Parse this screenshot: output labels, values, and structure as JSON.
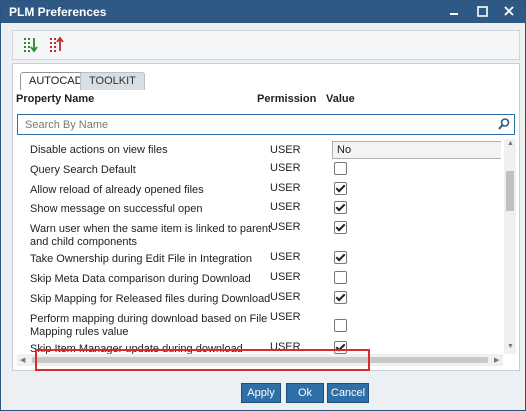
{
  "window": {
    "title": "PLM Preferences",
    "minimize_icon": "minimize-icon",
    "maximize_icon": "maximize-icon",
    "close_icon": "close-icon"
  },
  "toolbar": {
    "expand_icon": "expand-all-icon",
    "collapse_icon": "collapse-all-icon"
  },
  "tabs": [
    {
      "label": "AUTOCAD",
      "active": true
    },
    {
      "label": "TOOLKIT",
      "active": false
    }
  ],
  "headers": {
    "property": "Property Name",
    "permission": "Permission",
    "value": "Value"
  },
  "search": {
    "placeholder": "Search By Name",
    "value": ""
  },
  "rows": [
    {
      "name": "Disable actions on view files",
      "permission": "USER",
      "type": "dropdown",
      "value": "No"
    },
    {
      "name": "Query Search Default",
      "permission": "USER",
      "type": "checkbox",
      "checked": false
    },
    {
      "name": "Allow reload of already opened files",
      "permission": "USER",
      "type": "checkbox",
      "checked": true
    },
    {
      "name": "Show message on successful open",
      "permission": "USER",
      "type": "checkbox",
      "checked": true
    },
    {
      "name": "Warn user when the same item is linked to parent and child components",
      "permission": "USER",
      "type": "checkbox",
      "checked": true
    },
    {
      "name": "Take Ownership during Edit File in Integration",
      "permission": "USER",
      "type": "checkbox",
      "checked": true
    },
    {
      "name": "Skip Meta Data comparison during Download",
      "permission": "USER",
      "type": "checkbox",
      "checked": false
    },
    {
      "name": "Skip Mapping for Released files during Download",
      "permission": "USER",
      "type": "checkbox",
      "checked": true
    },
    {
      "name": "Perform mapping during download based on File Mapping rules value",
      "permission": "USER",
      "type": "checkbox",
      "checked": false
    },
    {
      "name": "Skip Item Manager update during download",
      "permission": "USER",
      "type": "checkbox",
      "checked": true
    }
  ],
  "buttons": {
    "apply": "Apply",
    "ok": "Ok",
    "cancel": "Cancel"
  },
  "colors": {
    "titlebar": "#2e5984",
    "button": "#2e6fa8",
    "highlight": "#d92b2b"
  }
}
